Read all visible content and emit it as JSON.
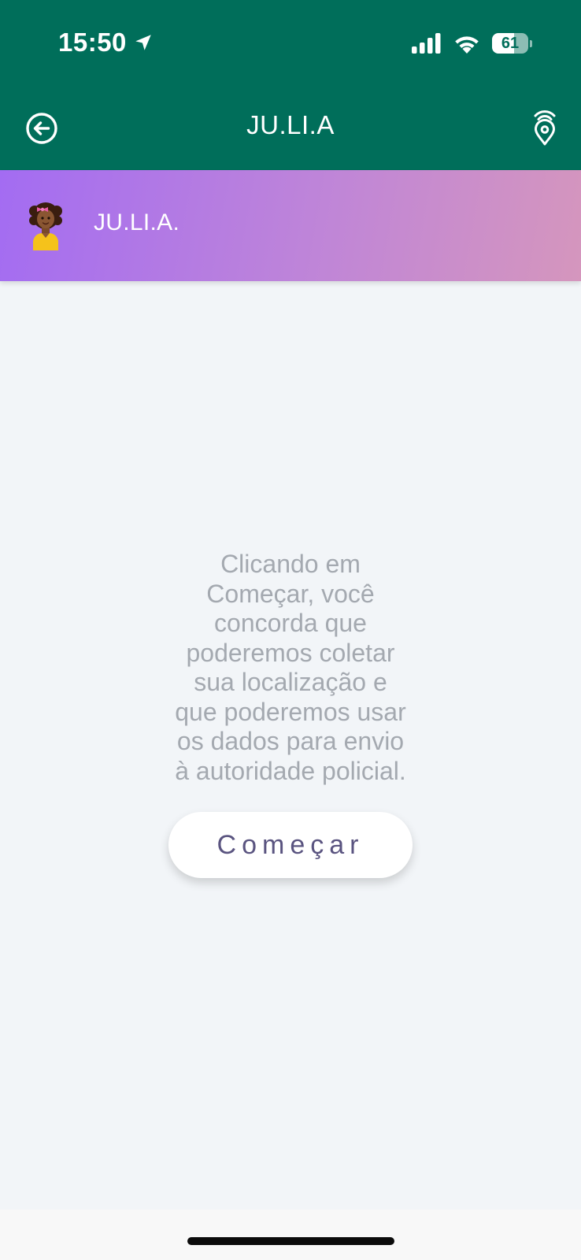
{
  "status_bar": {
    "time": "15:50",
    "battery_percent": "61",
    "battery_level": 0.61,
    "icons": [
      "location-arrow-icon",
      "signal-icon",
      "wifi-icon",
      "battery-icon"
    ]
  },
  "app_bar": {
    "title": "JU.LI.A",
    "left_icon": "back-arrow-circle-icon",
    "right_icon": "location-pin-signal-icon"
  },
  "assistant_header": {
    "name": "JU.LI.A.",
    "avatar_icon": "girl-avatar-icon"
  },
  "consent": {
    "lines": [
      "Clicando em",
      "Começar, você",
      "concorda que",
      "poderemos coletar",
      "sua localização e",
      "que poderemos usar",
      "os dados para envio",
      "à autoridade policial."
    ],
    "start_label": "Começar"
  },
  "colors": {
    "app_bar": "#006e5a",
    "header_gradient_start": "#a36cf2",
    "header_gradient_end": "#d596bd",
    "background": "#f2f5f8",
    "consent_text": "#a4a9b0",
    "button_text": "#5a5480"
  }
}
